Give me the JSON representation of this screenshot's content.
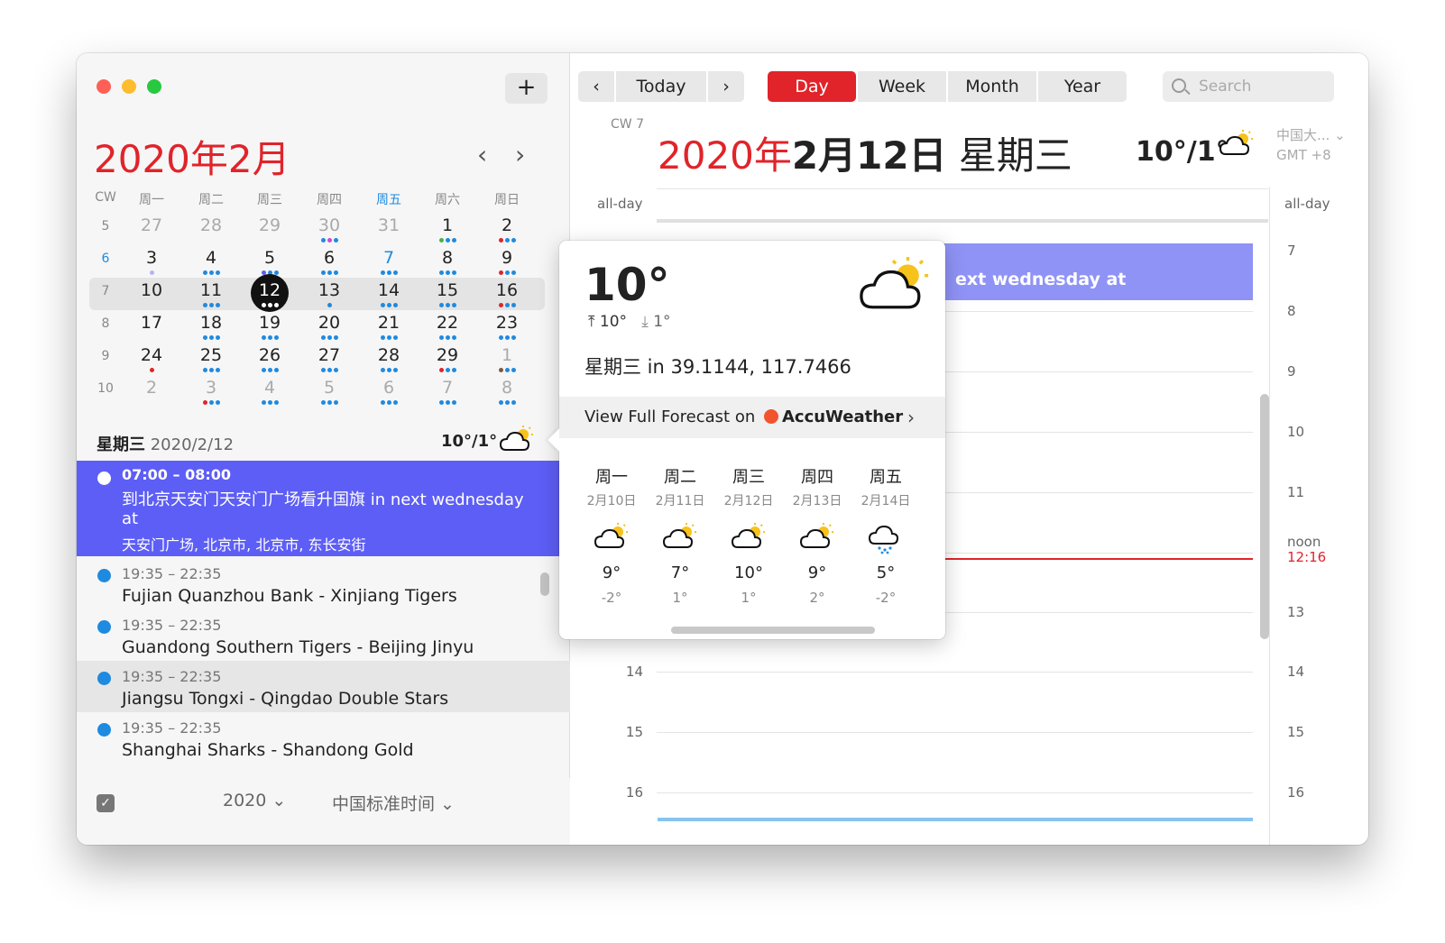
{
  "sidebar": {
    "add_label": "+",
    "month_title": "2020年2月",
    "prev": "‹",
    "next": "›",
    "cw_header": "CW",
    "weekdays": [
      "周一",
      "周二",
      "周三",
      "周四",
      "周五",
      "周六",
      "周日"
    ],
    "weeks": [
      {
        "cw": "5",
        "days": [
          "27",
          "28",
          "29",
          "30",
          "31",
          "1",
          "2"
        ]
      },
      {
        "cw": "6",
        "days": [
          "3",
          "4",
          "5",
          "6",
          "7",
          "8",
          "9"
        ]
      },
      {
        "cw": "7",
        "days": [
          "10",
          "11",
          "12",
          "13",
          "14",
          "15",
          "16"
        ]
      },
      {
        "cw": "8",
        "days": [
          "17",
          "18",
          "19",
          "20",
          "21",
          "22",
          "23"
        ]
      },
      {
        "cw": "9",
        "days": [
          "24",
          "25",
          "26",
          "27",
          "28",
          "29",
          "1"
        ]
      },
      {
        "cw": "10",
        "days": [
          "2",
          "3",
          "4",
          "5",
          "6",
          "7",
          "8"
        ]
      }
    ],
    "selected_weekday": "星期三",
    "selected_date": "2020/2/12",
    "day_weather": "10°/1°",
    "selected_event": {
      "time": "07:00 – 08:00",
      "title": "到北京天安门天安门广场看升国旗 in next wednesday",
      "title_cont": "at",
      "location": "天安门广场, 北京市, 北京市, 东长安街"
    },
    "events": [
      {
        "time": "19:35 – 22:35",
        "title": "Fujian Quanzhou Bank - Xinjiang Tigers"
      },
      {
        "time": "19:35 – 22:35",
        "title": "Guandong Southern Tigers - Beijing Jinyu"
      },
      {
        "time": "19:35 – 22:35",
        "title": "Jiangsu Tongxi - Qingdao Double Stars"
      },
      {
        "time": "19:35 – 22:35",
        "title": "Shanghai Sharks - Shandong Gold"
      }
    ],
    "footer": {
      "checkbox": "✓",
      "year": "2020 ⌄",
      "timezone": "中国标准时间 ⌄"
    }
  },
  "toolbar": {
    "prev": "‹",
    "today": "Today",
    "next": "›",
    "views": [
      "Day",
      "Week",
      "Month",
      "Year"
    ],
    "active_view": "Day",
    "search_placeholder": "Search"
  },
  "day": {
    "cw": "CW 7",
    "date_red": "2020年",
    "date_bold": "2月12日",
    "date_weekday": " 星期三",
    "temp": "10°/1°",
    "tz_name": "中国大... ⌄",
    "tz_offset": "GMT +8",
    "all_day": "all-day",
    "hours": [
      "7",
      "8",
      "9",
      "10",
      "11",
      "13",
      "14",
      "15",
      "16"
    ],
    "noon": "noon",
    "now": "12:16",
    "event_block": "ext wednesday at"
  },
  "popover": {
    "temp": "10°",
    "high": "10°",
    "low": "1°",
    "location": "星期三 in 39.1144, 117.7466",
    "forecast_prefix": "View Full Forecast on ",
    "forecast_brand": "AccuWeather",
    "chevron": "›",
    "forecast": [
      {
        "wd": "周一",
        "date": "2月10日",
        "hi": "9°",
        "lo": "-2°",
        "icon": "partly-cloudy-icon"
      },
      {
        "wd": "周二",
        "date": "2月11日",
        "hi": "7°",
        "lo": "1°",
        "icon": "partly-cloudy-icon"
      },
      {
        "wd": "周三",
        "date": "2月12日",
        "hi": "10°",
        "lo": "1°",
        "icon": "partly-cloudy-icon"
      },
      {
        "wd": "周四",
        "date": "2月13日",
        "hi": "9°",
        "lo": "2°",
        "icon": "partly-cloudy-icon"
      },
      {
        "wd": "周五",
        "date": "2月14日",
        "hi": "5°",
        "lo": "-2°",
        "icon": "rain-cloud-icon"
      }
    ]
  },
  "colors": {
    "accent": "#e0242a",
    "selection": "#5d5ef5",
    "event_block": "#8f93f6",
    "dot_blue": "#1e8ae0"
  }
}
